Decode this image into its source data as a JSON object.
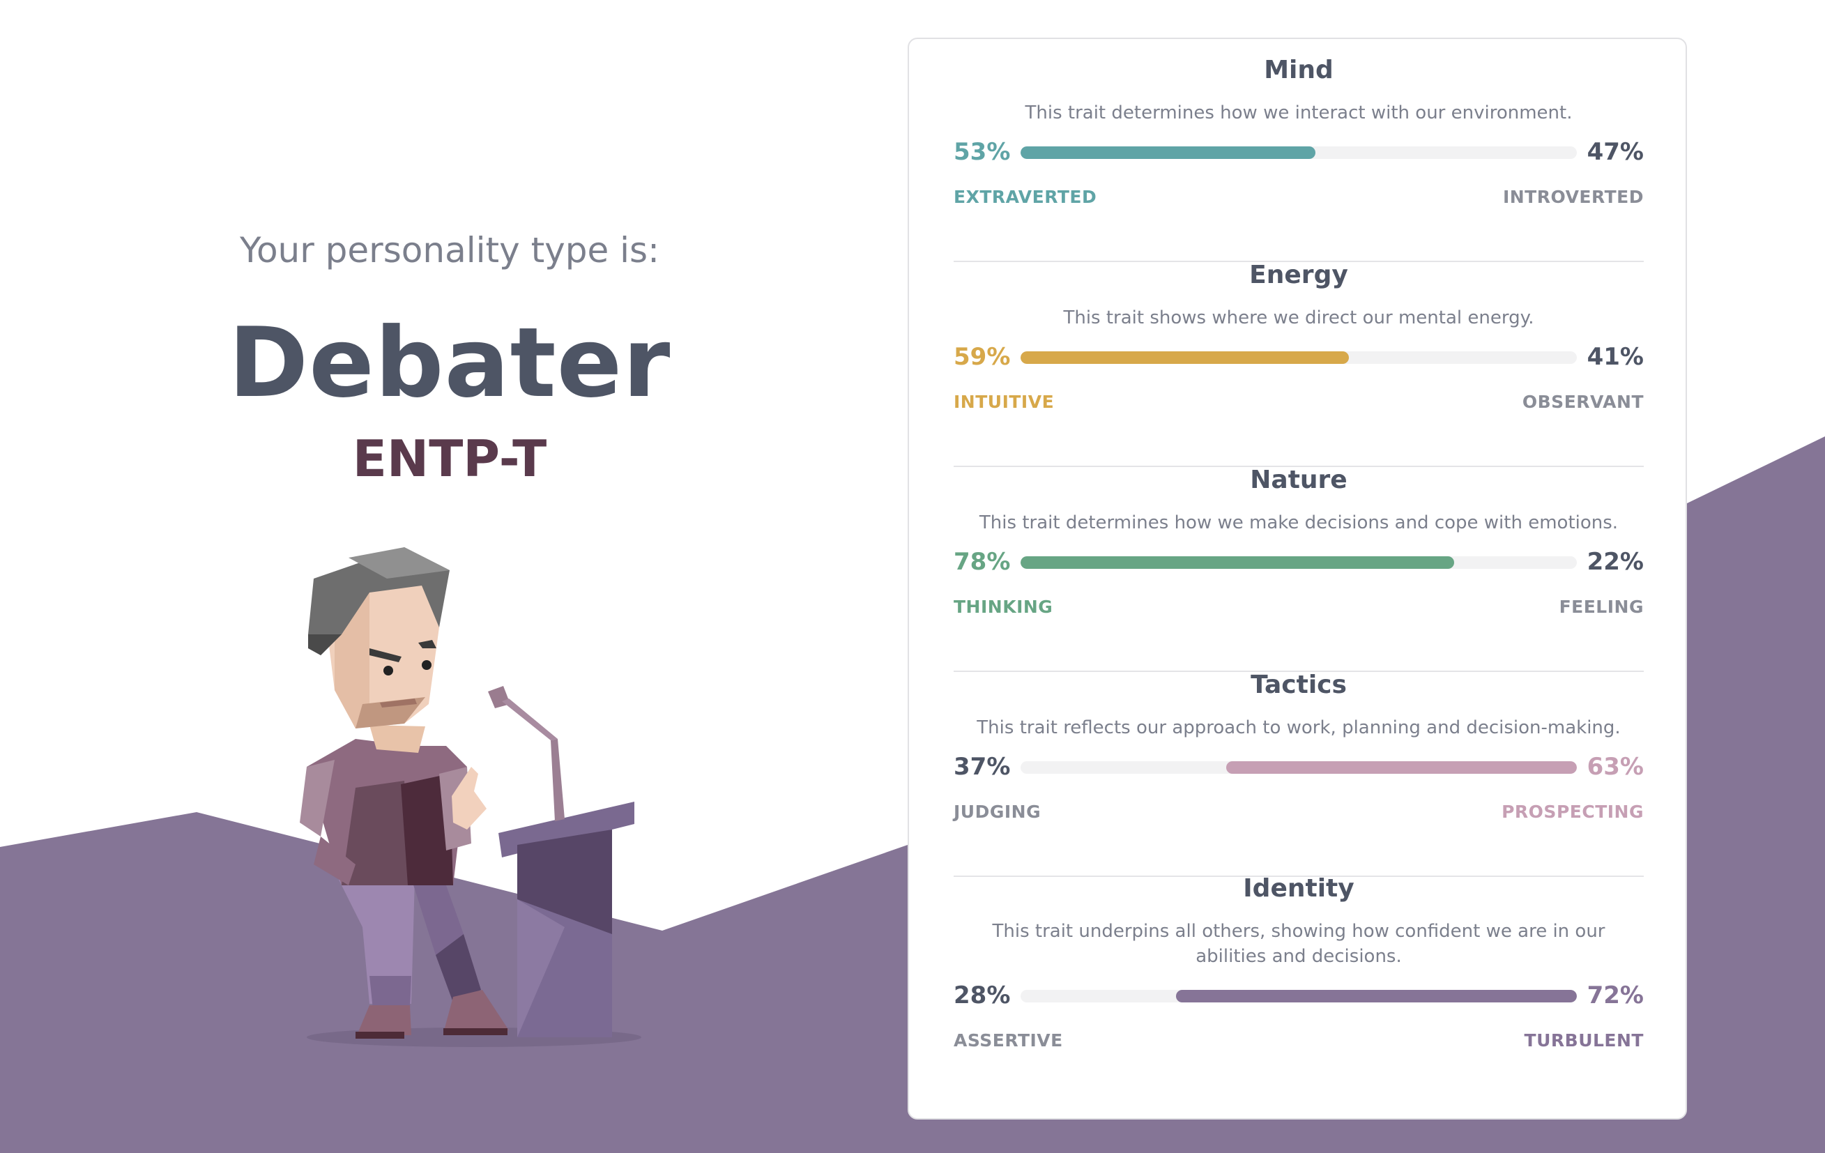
{
  "hero": {
    "intro": "Your personality type is:",
    "type_name": "Debater",
    "type_code": "ENTP-T"
  },
  "colors": {
    "background_purple": "#857596",
    "title_dark": "#4e5565",
    "code_maroon": "#5a3a4c",
    "muted_text": "#7b7f8c",
    "track": "#f2f2f3"
  },
  "traits": [
    {
      "title": "Mind",
      "description": "This trait determines how we interact with our environment.",
      "left_percent": "53%",
      "right_percent": "47%",
      "left_label": "EXTRAVERTED",
      "right_label": "INTROVERTED",
      "dominant": "left",
      "value": 53,
      "color": "#5fa4a6"
    },
    {
      "title": "Energy",
      "description": "This trait shows where we direct our mental energy.",
      "left_percent": "59%",
      "right_percent": "41%",
      "left_label": "INTUITIVE",
      "right_label": "OBSERVANT",
      "dominant": "left",
      "value": 59,
      "color": "#d7a84a"
    },
    {
      "title": "Nature",
      "description": "This trait determines how we make decisions and cope with emotions.",
      "left_percent": "78%",
      "right_percent": "22%",
      "left_label": "THINKING",
      "right_label": "FEELING",
      "dominant": "left",
      "value": 78,
      "color": "#67a584"
    },
    {
      "title": "Tactics",
      "description": "This trait reflects our approach to work, planning and decision-making.",
      "left_percent": "37%",
      "right_percent": "63%",
      "left_label": "JUDGING",
      "right_label": "PROSPECTING",
      "dominant": "right",
      "value": 63,
      "color": "#c69fb4"
    },
    {
      "title": "Identity",
      "description": "This trait underpins all others, showing how confident we are in our abilities and decisions.",
      "left_percent": "28%",
      "right_percent": "72%",
      "left_label": "ASSERTIVE",
      "right_label": "TURBULENT",
      "dominant": "right",
      "value": 72,
      "color": "#867497"
    }
  ]
}
